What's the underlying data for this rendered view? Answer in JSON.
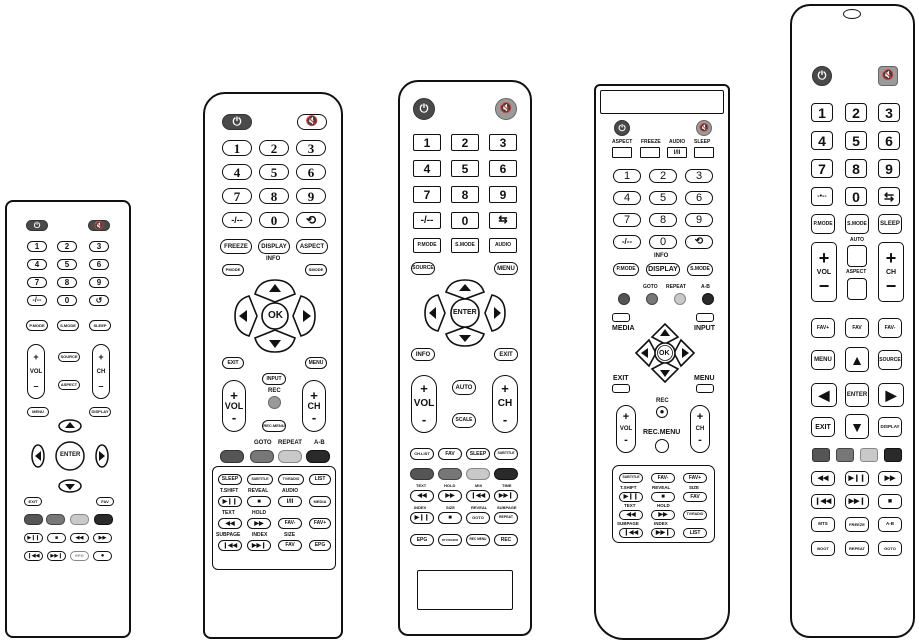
{
  "remote1": {
    "digits": [
      "1",
      "2",
      "3",
      "4",
      "5",
      "6",
      "7",
      "8",
      "9",
      "-/--",
      "0",
      "↺"
    ],
    "row_mode": [
      "P.MODE",
      "S.MODE",
      "SLEEP"
    ],
    "source": "SOURCE",
    "aspect": "ASPECT",
    "vol": "VOL",
    "ch": "CH",
    "menu": "MENU",
    "display": "DISPLAY",
    "enter": "ENTER",
    "exit": "EXIT",
    "fav": "FAV",
    "epg": "EPG"
  },
  "remote2": {
    "digits": [
      "1",
      "2",
      "3",
      "4",
      "5",
      "6",
      "7",
      "8",
      "9",
      "-/--",
      "0",
      "⟲"
    ],
    "row_a": [
      "FREEZE",
      "DISPLAY",
      "ASPECT"
    ],
    "info": "INFO",
    "pmode": "PMODE",
    "smode": "SMODE",
    "ok": "OK",
    "exit": "EXIT",
    "menu": "MENU",
    "input": "INPUT",
    "rec": "REC",
    "rec_menu": "REC.MENU",
    "vol": "VOL",
    "ch": "CH",
    "color_labels": [
      "GOTO",
      "REPEAT",
      "A-B"
    ],
    "row1": [
      "SLEEP",
      "SUBTITLE",
      "TV/RADIO",
      "LIST"
    ],
    "row2_labels": [
      "T.SHIFT",
      "REVEAL",
      "AUDIO"
    ],
    "media": "MEDIA",
    "row3_labels": [
      "TEXT",
      "HOLD"
    ],
    "fav_minus": "FAV-",
    "fav_plus": "FAV+",
    "row4_labels": [
      "SUBPAGE",
      "INDEX",
      "SIZE"
    ],
    "fav": "FAV",
    "epg": "EPG"
  },
  "remote3": {
    "digits": [
      "1",
      "2",
      "3",
      "4",
      "5",
      "6",
      "7",
      "8",
      "9",
      "-/--",
      "0",
      "⇆"
    ],
    "modes": [
      "P.MODE",
      "S.MODE",
      "AUDIO"
    ],
    "source": "SOURCE",
    "menu": "MENU",
    "enter": "ENTER",
    "info": "INFO",
    "exit": "EXIT",
    "auto": "AUTO",
    "scale": "SCALE",
    "vol": "VOL",
    "ch": "CH",
    "row_a": [
      "CH.LIST",
      "FAV",
      "SLEEP",
      "SUBTITLE"
    ],
    "row_b_labels": [
      "TEXT",
      "HOLD",
      "MIX",
      "TIME"
    ],
    "row_c_labels": [
      "INDEX",
      "SIZE",
      "REVEAL",
      "SUBPAGE"
    ],
    "goto": "GOTO",
    "repeat": "REPEAT",
    "row_d": [
      "EPG",
      "DTV/RADIO",
      "REC MENU",
      "REC"
    ]
  },
  "remote4": {
    "top_labels": [
      "ASPECT",
      "FREEZE",
      "AUDIO",
      "SLEEP"
    ],
    "audio_key": "I/II",
    "digits": [
      "1",
      "2",
      "3",
      "4",
      "5",
      "6",
      "7",
      "8",
      "9",
      "-/--",
      "0",
      "⟲"
    ],
    "info": "INFO",
    "pmode": "P.MODE",
    "display": "DISPLAY",
    "smode": "S.MODE",
    "color_labels": [
      "GOTO",
      "REPEAT",
      "A-B"
    ],
    "media": "MEDIA",
    "input": "INPUT",
    "exit": "EXIT",
    "menu": "MENU",
    "rec": "REC",
    "rec_menu": "REC.MENU",
    "vol": "VOL",
    "ch": "CH",
    "row1": [
      "SUBTITLE",
      "FAV-",
      "FAV+"
    ],
    "row2_labels": [
      "T.SHIFT",
      "REVEAL",
      "SIZE"
    ],
    "fav": "FAV",
    "row3_labels": [
      "TEXT",
      "HOLD"
    ],
    "tvradio": "TV/RADIO",
    "row4_labels": [
      "SUBPAGE",
      "INDEX"
    ],
    "list": "LIST"
  },
  "remote5": {
    "digits": [
      "1",
      "2",
      "3",
      "4",
      "5",
      "6",
      "7",
      "8",
      "9",
      "-•--",
      "0",
      "⇆"
    ],
    "modes": [
      "P.MODE",
      "S.MODE",
      "SLEEP"
    ],
    "auto": "AUTO",
    "vol": "VOL",
    "ch": "CH",
    "aspect": "ASPECT",
    "favs": [
      "FAV+",
      "FAV",
      "FAV-"
    ],
    "menu": "MENU",
    "source": "SOURCE",
    "enter": "ENTER",
    "exit": "EXIT",
    "display": "DISPLAY",
    "bottom_a": [
      "MTS",
      "FREEZE",
      "A-B"
    ],
    "bottom_b": [
      "BOOT",
      "REPEAT",
      "GOTO"
    ]
  }
}
